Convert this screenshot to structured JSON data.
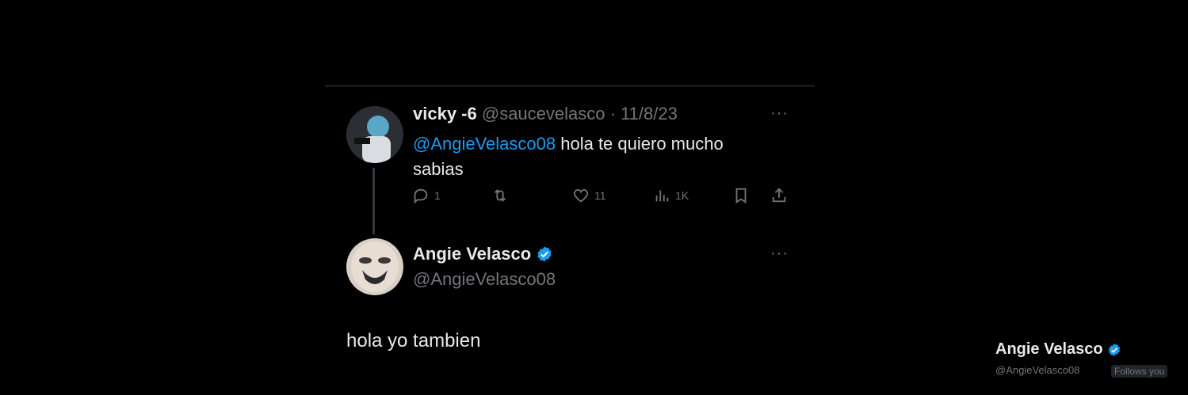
{
  "tweet": {
    "author_name": "vicky -6",
    "author_handle": "@saucevelasco",
    "separator": "·",
    "date": "11/8/23",
    "mention": "@AngieVelasco08",
    "text_line1": " hola te quiero mucho",
    "text_line2": "sabias",
    "more_label": "···",
    "actions": {
      "reply_count": "1",
      "like_count": "11",
      "views_count": "1K"
    }
  },
  "reply": {
    "author_name": "Angie Velasco",
    "author_handle": "@AngieVelasco08",
    "more_label": "···",
    "text": "hola yo tambien"
  },
  "profile_card": {
    "name": "Angie Velasco",
    "handle": "@AngieVelasco08",
    "follows_badge": "Follows you"
  },
  "colors": {
    "background": "#000000",
    "text_primary": "#e7e9ea",
    "text_secondary": "#71767b",
    "accent": "#1d9bf0"
  }
}
